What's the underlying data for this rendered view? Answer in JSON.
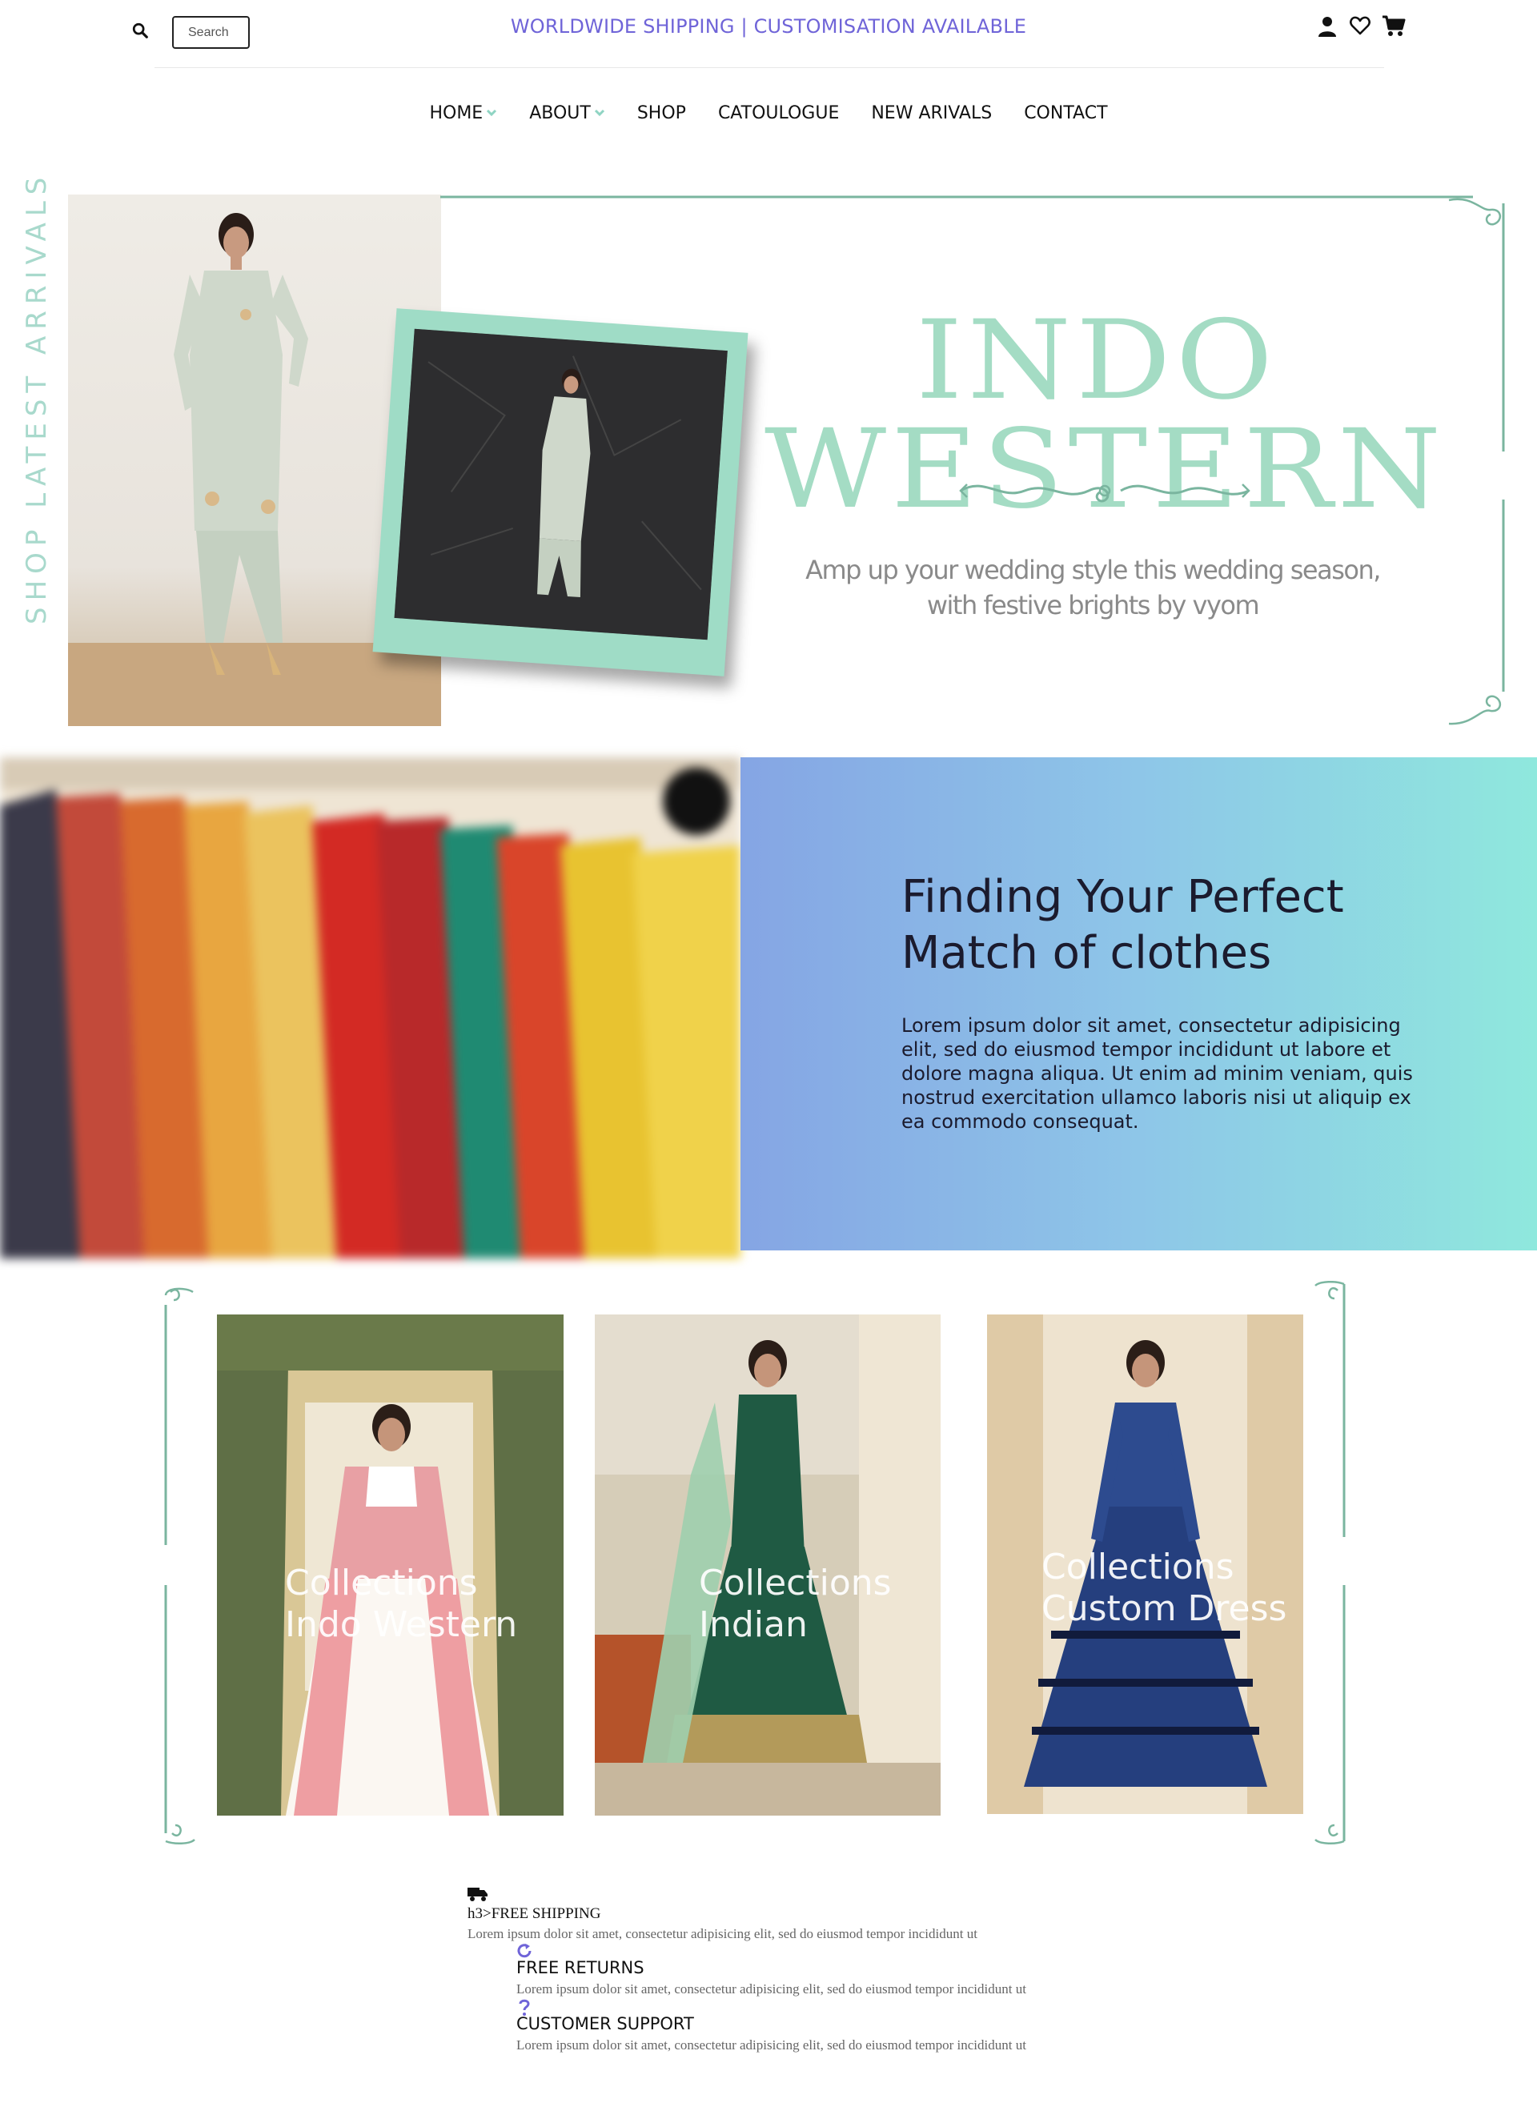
{
  "topbar": {
    "search_placeholder": "Search",
    "promo": "WORLDWIDE SHIPPING | CUSTOMISATION AVAILABLE",
    "icons": [
      "search-icon",
      "user-icon",
      "heart-icon",
      "cart-icon"
    ]
  },
  "nav": {
    "items": [
      {
        "label": "HOME",
        "dropdown": true
      },
      {
        "label": "ABOUT",
        "dropdown": true
      },
      {
        "label": "SHOP",
        "dropdown": false
      },
      {
        "label": "CATOULOGUE",
        "dropdown": false
      },
      {
        "label": "NEW ARIVALS",
        "dropdown": false
      },
      {
        "label": "CONTACT",
        "dropdown": false
      }
    ]
  },
  "hero": {
    "vertical_text": "SHOP LATEST ARRIVALS",
    "title": "INDO WESTERN",
    "tagline_line1": "Amp up your wedding style this wedding season,",
    "tagline_line2": "with festive brights by vyom"
  },
  "about": {
    "heading_line1": "Finding Your Perfect",
    "heading_line2": "Match of clothes",
    "text": "Lorem ipsum dolor sit amet, consectetur adipisicing elit, sed do eiusmod tempor incididunt ut labore et dolore magna aliqua. Ut enim ad minim veniam, quis nostrud exercitation ullamco laboris nisi ut aliquip ex ea commodo consequat."
  },
  "collections": [
    {
      "line1": "Collections",
      "line2": "Indo Western"
    },
    {
      "line1": "Collections",
      "line2": "Indian"
    },
    {
      "line1": "Collections",
      "line2": "Custom Dress"
    }
  ],
  "features": {
    "shipping_raw": "h3>FREE SHIPPING",
    "shipping_text": "Lorem ipsum dolor sit amet, consectetur adipisicing elit, sed do eiusmod tempor incididunt ut",
    "returns_title": "FREE RETURNS",
    "returns_text": "Lorem ipsum dolor sit amet, consectetur adipisicing elit, sed do eiusmod tempor incididunt ut",
    "support_title": "CUSTOMER SUPPORT",
    "support_text": "Lorem ipsum dolor sit amet, consectetur adipisicing elit, sed do eiusmod tempor incididunt ut"
  },
  "colors": {
    "accent": "#6f64d8",
    "mint": "#a4dcc4",
    "frame_green": "#7ab59f"
  }
}
